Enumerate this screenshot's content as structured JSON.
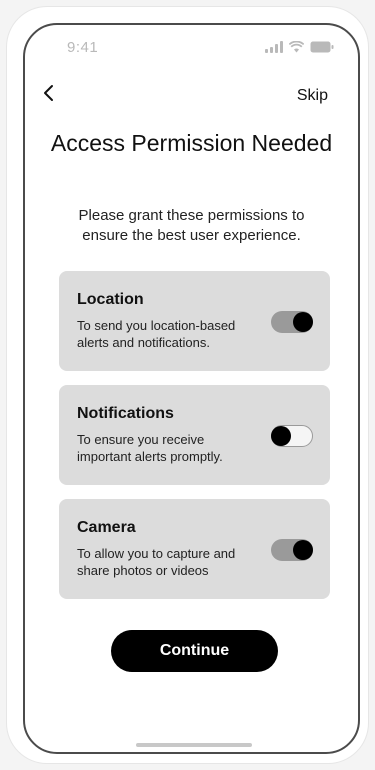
{
  "status_bar": {
    "time": "9:41",
    "icons": [
      "signal-icon",
      "wifi-icon",
      "battery-icon"
    ]
  },
  "nav": {
    "back_icon": "chevron-left-icon",
    "skip_label": "Skip"
  },
  "title": "Access Permission Needed",
  "subtitle": "Please grant these permissions to ensure the best user experience.",
  "permissions": [
    {
      "title": "Location",
      "description": "To send you location-based alerts and notifications.",
      "enabled": true
    },
    {
      "title": "Notifications",
      "description": "To ensure you receive important alerts promptly.",
      "enabled": false
    },
    {
      "title": "Camera",
      "description": "To allow you to capture and share photos or videos",
      "enabled": true
    }
  ],
  "continue_label": "Continue",
  "colors": {
    "card_background": "#dcdcdc",
    "toggle_on_track": "#9a9a9a",
    "toggle_knob": "#000000",
    "button_background": "#000000",
    "button_text": "#ffffff"
  }
}
